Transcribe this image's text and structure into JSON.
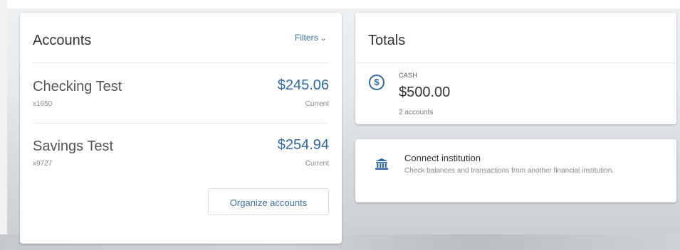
{
  "accounts": {
    "title": "Accounts",
    "filters_label": "Filters",
    "items": [
      {
        "name": "Checking Test",
        "number": "x1650",
        "amount": "$245.06",
        "status": "Current"
      },
      {
        "name": "Savings Test",
        "number": "x9727",
        "amount": "$254.94",
        "status": "Current"
      }
    ],
    "organize_label": "Organize accounts"
  },
  "totals": {
    "title": "Totals",
    "cash": {
      "icon": "dollar-circle-icon",
      "label": "CASH",
      "amount": "$500.00",
      "accounts_count": "2 accounts"
    }
  },
  "connect": {
    "icon": "bank-icon",
    "title": "Connect institution",
    "description": "Check balances and transactions from another financial institution."
  },
  "colors": {
    "accent": "#2f6aa7",
    "link": "#3b6fa5",
    "text_primary": "#333333",
    "text_muted": "#888888"
  }
}
